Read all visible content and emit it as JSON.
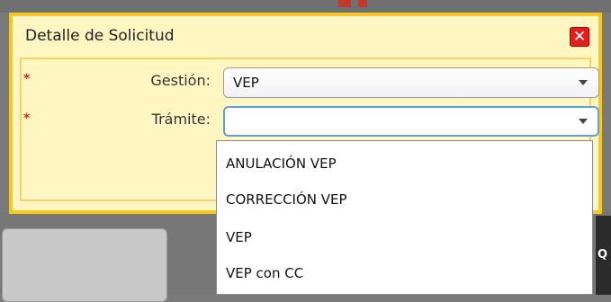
{
  "dialog": {
    "title": "Detalle de Solicitud",
    "close_glyph": "✕",
    "required_marker": "*",
    "fields": {
      "gestion": {
        "label": "Gestión:",
        "value": "VEP"
      },
      "tramite": {
        "label": "Trámite:",
        "value": ""
      }
    }
  },
  "dropdown": {
    "options": [
      "ANULACIÓN VEP",
      "CORRECCIÓN VEP",
      "VEP",
      "VEP con CC"
    ]
  },
  "background": {
    "right_text": "Q"
  },
  "colors": {
    "dialog_border": "#f5c825",
    "dialog_fill": "#fff6c2",
    "required": "#e02020",
    "focus": "#5fa0d8"
  }
}
